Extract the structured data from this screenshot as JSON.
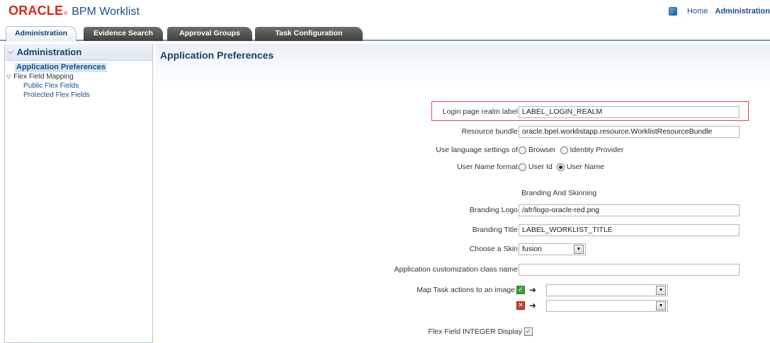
{
  "header": {
    "logo_text": "ORACLE",
    "logo_mark": "®",
    "app_name": "BPM Worklist",
    "globe_icon": "globe-icon",
    "links": {
      "home": "Home",
      "administration": "Administration"
    }
  },
  "tabs": [
    {
      "label": "Administration",
      "active": true
    },
    {
      "label": "Evidence Search"
    },
    {
      "label": "Approval Groups"
    },
    {
      "label": "Task Configuration"
    }
  ],
  "sidebar": {
    "title": "Administration",
    "collapse_icon": "chevron-down-icon",
    "items": [
      {
        "label": "Application Preferences"
      },
      {
        "label": "Flex Field Mapping"
      },
      {
        "label": "Public Flex Fields"
      },
      {
        "label": "Protected Flex Fields"
      }
    ]
  },
  "main": {
    "title": "Application Preferences",
    "form": {
      "login_realm_label": "Login page realm label",
      "login_realm_value": "LABEL_LOGIN_REALM",
      "resource_bundle_label": "Resource bundle",
      "resource_bundle_value": "oracle.bpel.worklistapp.resource.WorklistResourceBundle",
      "language_label": "Use language settings of",
      "language_options": [
        "Browser",
        "Identity Provider"
      ],
      "username_label": "User Name format",
      "username_options": [
        "User Id",
        "User Name"
      ],
      "username_selected": "User Name",
      "branding_section": "Branding And Skinning",
      "branding_logo_label": "Branding Logo",
      "branding_logo_value": "/afr/logo-oracle-red.png",
      "branding_title_label": "Branding Title",
      "branding_title_value": "LABEL_WORKLIST_TITLE",
      "skin_label": "Choose a Skin",
      "skin_value": "fusion",
      "customization_label": "Application customization class name",
      "customization_value": "",
      "map_actions_label": "Map Task actions to an image",
      "map_action_icons": [
        "approve-icon",
        "reject-icon"
      ],
      "flex_integer_label": "Flex Field INTEGER Display",
      "flex_integer_checked": true
    }
  }
}
